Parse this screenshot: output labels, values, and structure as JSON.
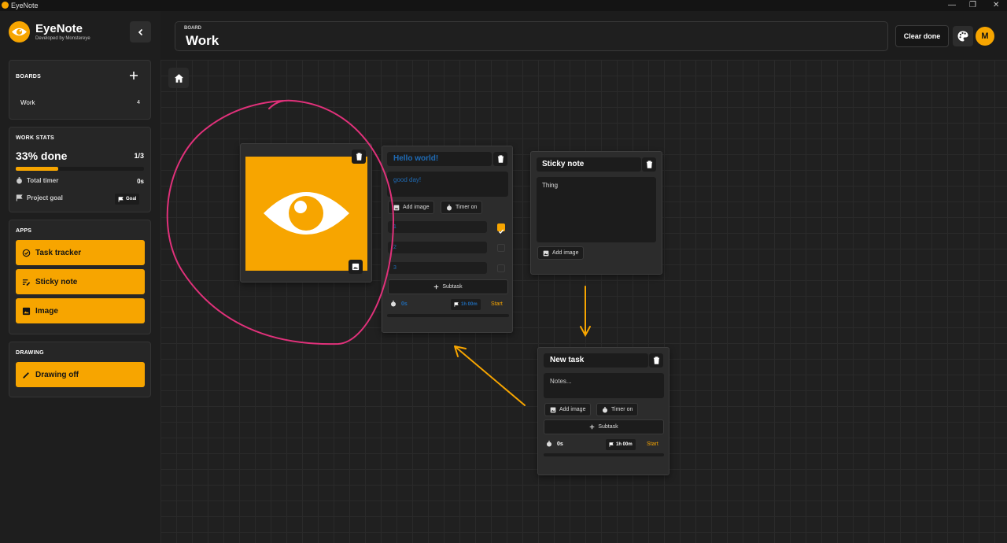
{
  "window": {
    "title": "EyeNote",
    "min": "—",
    "max": "❐",
    "close": "✕"
  },
  "brand": {
    "name": "EyeNote",
    "subtitle": "Developed by Monstereye"
  },
  "sidebar": {
    "boards_heading": "BOARDS",
    "boards": [
      {
        "name": "Work",
        "count": "4"
      }
    ],
    "stats_heading": "WORK STATS",
    "percent_done": "33% done",
    "fraction": "1/3",
    "progress": 0.33,
    "total_timer_label": "Total timer",
    "total_timer_value": "0s",
    "project_goal_label": "Project goal",
    "goal_chip": "Goal",
    "apps_heading": "APPS",
    "apps": [
      "Task tracker",
      "Sticky note",
      "Image"
    ],
    "drawing_heading": "DRAWING",
    "drawing_button": "Drawing off"
  },
  "header": {
    "board_caption": "BOARD",
    "board_title": "Work",
    "clear_done": "Clear done",
    "avatar_initial": "M"
  },
  "cards": {
    "hello_task": {
      "title": "Hello world!",
      "notes": "good day!",
      "add_image": "Add image",
      "timer_toggle": "Timer on",
      "subtasks": [
        {
          "text": "1",
          "done": true
        },
        {
          "text": "2",
          "done": false
        },
        {
          "text": "3",
          "done": false
        }
      ],
      "add_subtask": "Subtask",
      "elapsed": "0s",
      "goal": "1h 00m",
      "start": "Start",
      "progress": 0
    },
    "sticky": {
      "title": "Sticky note",
      "body": "Thing",
      "add_image": "Add image"
    },
    "new_task": {
      "title": "New task",
      "notes_placeholder": "Notes...",
      "add_image": "Add image",
      "timer_toggle": "Timer on",
      "add_subtask": "Subtask",
      "elapsed": "0s",
      "goal": "1h 00m",
      "start": "Start",
      "progress": 0
    }
  },
  "colors": {
    "accent": "#f7a500",
    "drawing_pink": "#e0317a",
    "drawing_orange": "#f7a500",
    "link_blue": "#1f6bb5"
  }
}
